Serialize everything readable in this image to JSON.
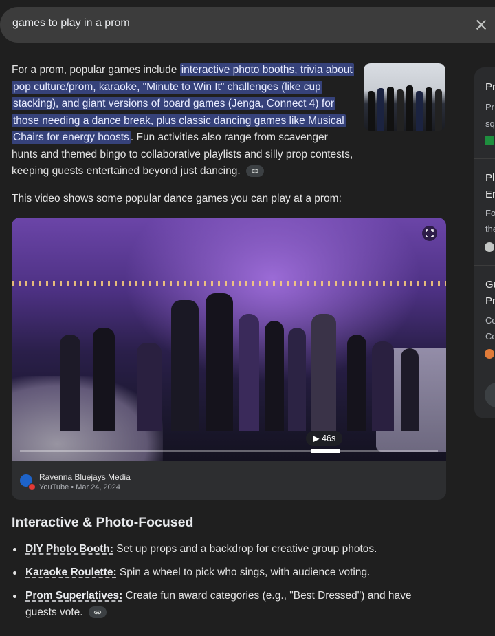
{
  "search": {
    "query": "games to play in a prom"
  },
  "overview": {
    "intro": "For a prom, popular games include ",
    "highlight": "interactive photo booths, trivia about pop culture/prom, karaoke, \"Minute to Win It\" challenges (like cup stacking), and giant versions of board games (Jenga, Connect 4) for those needing a dance break, plus classic dancing games like Musical Chairs for energy boosts",
    "rest": ". Fun activities also range from scavenger hunts and themed bingo to collaborative playlists and silly prop contests, keeping guests entertained beyond just dancing."
  },
  "video": {
    "intro_text": "This video shows some popular dance games you can play at a prom:",
    "duration": "46s",
    "progress_fraction": 0.73,
    "channel": "Ravenna Bluejays Media",
    "meta": "YouTube • Mar 24, 2024"
  },
  "section": {
    "title": "Interactive & Photo-Focused",
    "items": [
      {
        "term": "DIY Photo Booth:",
        "text": " Set up props and a backdrop for creative group photos."
      },
      {
        "term": "Karaoke Roulette:",
        "text": " Spin a wheel to pick who sings, with audience voting."
      },
      {
        "term": "Prom Superlatives:",
        "text": " Create fun award categories (e.g., \"Best Dressed\") and have guests vote."
      }
    ]
  },
  "side_panel": {
    "c1_title": "Pr",
    "c1_line1": "Pr",
    "c1_line2": "sq",
    "c2_title_1": "Pl",
    "c2_title_2": "En",
    "c2_line1": "Fo",
    "c2_line2": "the",
    "c3_title_1": "Gu",
    "c3_title_2": "Pr",
    "c3_line1": "Co",
    "c3_line2": "Co"
  },
  "colors": {
    "background": "#1f1f1f",
    "highlight": "#36427a",
    "search_bar": "#3c3c3c"
  }
}
